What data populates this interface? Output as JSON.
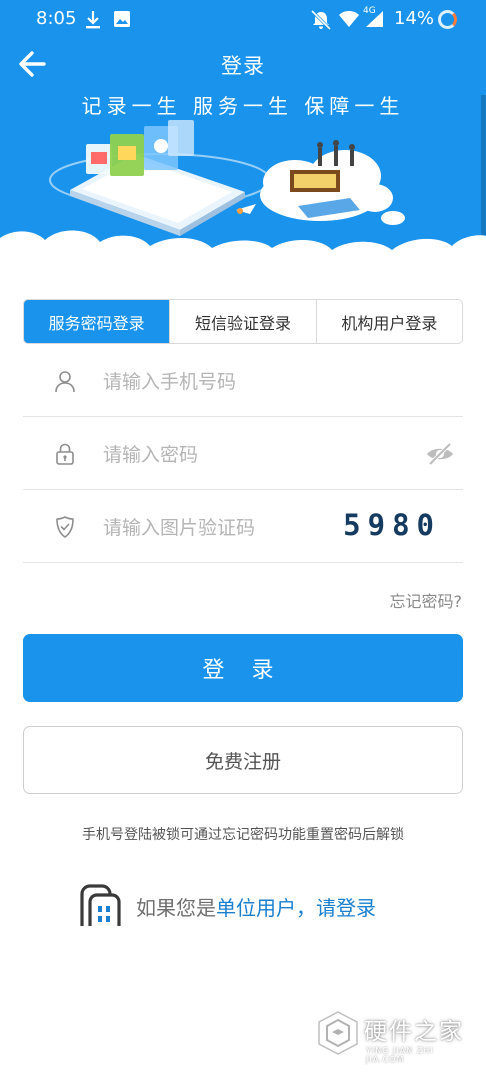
{
  "status_bar": {
    "time": "8:05",
    "network": "4G",
    "battery": "14%",
    "icons": [
      "download-icon",
      "image-icon",
      "mute-icon",
      "wifi-icon",
      "signal-icon",
      "battery-ring-icon"
    ]
  },
  "header": {
    "title": "登录",
    "slogan": "记录一生  服务一生  保障一生",
    "background": "#1a93ec"
  },
  "tabs": [
    {
      "label": "服务密码登录",
      "active": true
    },
    {
      "label": "短信验证登录",
      "active": false
    },
    {
      "label": "机构用户登录",
      "active": false
    }
  ],
  "form": {
    "phone_placeholder": "请输入手机号码",
    "password_placeholder": "请输入密码",
    "captcha_placeholder": "请输入图片验证码",
    "captcha_code": "5980"
  },
  "forgot_link": "忘记密码?",
  "login_button": "登 录",
  "register_button": "免费注册",
  "hint": "手机号登陆被锁可通过忘记密码功能重置密码后解锁",
  "org_link": {
    "prefix": "如果您是",
    "strong": "单位用户",
    "separator": "，",
    "action": "请登录"
  },
  "watermark": {
    "title": "硬件之家",
    "subtitle": "YING JIAN ZHI JIA.COM"
  },
  "colors": {
    "accent": "#1a93ec",
    "link": "#1a7fcf",
    "placeholder": "#b5b5b5"
  }
}
